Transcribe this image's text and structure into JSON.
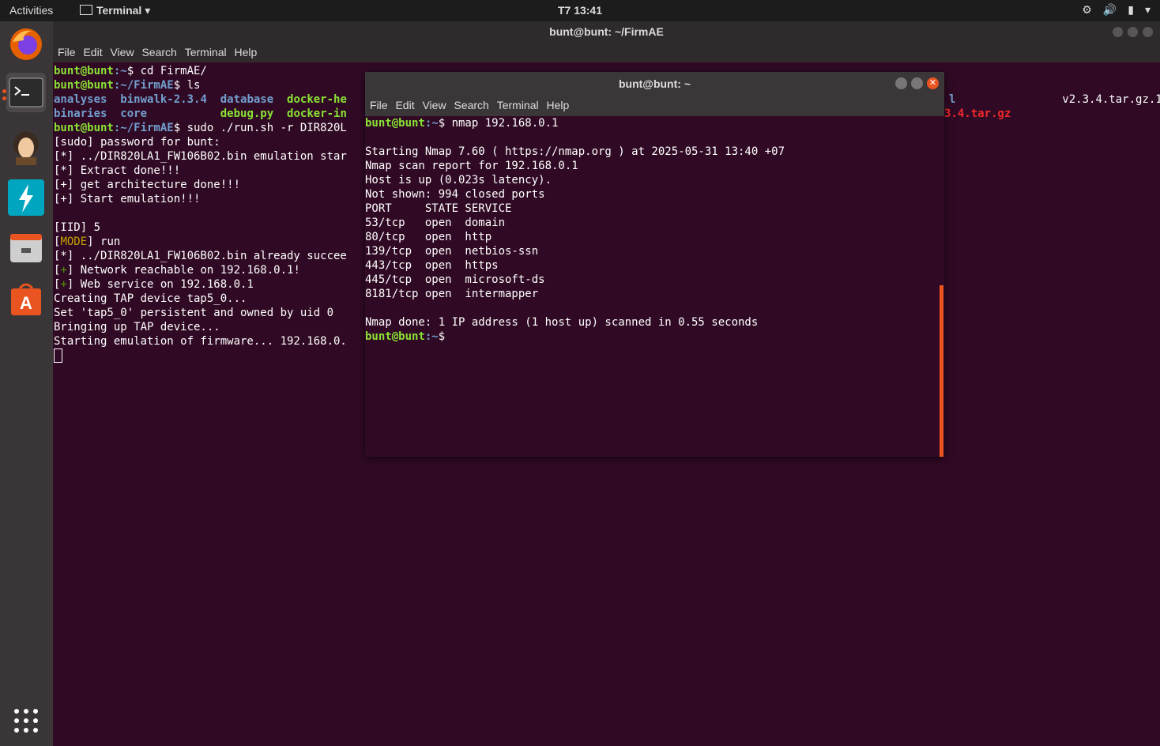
{
  "topbar": {
    "activities": "Activities",
    "app_menu": "Terminal",
    "clock": "T7 13:41"
  },
  "dock": {
    "items": [
      "firefox-icon",
      "terminal-icon",
      "gimp-icon",
      "zap-icon",
      "files-icon",
      "software-center-icon"
    ],
    "active": "terminal-icon",
    "accent": "#e95420"
  },
  "main_window": {
    "title": "bunt@bunt: ~/FirmAE",
    "menu": [
      "File",
      "Edit",
      "View",
      "Search",
      "Terminal",
      "Help"
    ],
    "lines": {
      "l1_prompt": "bunt@bunt",
      "l1_path": ":~",
      "l1_cmd": "$ cd FirmAE/",
      "l2_prompt": "bunt@bunt",
      "l2_path": ":~/FirmAE",
      "l2_cmd": "$ ls",
      "ls_row1_a": "analyses",
      "ls_row1_b": "binwalk-2.3.4",
      "ls_row1_c": "database",
      "ls_row1_d": "docker-he",
      "ls_row1_e": "l",
      "ls_row1_f": "v2.3.4.tar.gz.1",
      "ls_row2_a": "binaries",
      "ls_row2_b": "core",
      "ls_row2_c": "debug.py",
      "ls_row2_d": "docker-in",
      "ls_row2_e": "3.4.tar.gz",
      "l5_prompt": "bunt@bunt",
      "l5_path": ":~/FirmAE",
      "l5_cmd": "$ sudo ./run.sh -r DIR820L",
      "l6": "[sudo] password for bunt:",
      "l7": "[*] ../DIR820LA1_FW106B02.bin emulation star",
      "l8": "[*] Extract done!!!",
      "l9": "[+] get architecture done!!!",
      "l10": "[+] Start emulation!!!",
      "l11": "",
      "l12": "[IID] 5",
      "l13_open": "[",
      "l13_mode": "MODE",
      "l13_close": "] run",
      "l14": "[*] ../DIR820LA1_FW106B02.bin already succee",
      "l15_open": "[",
      "l15_plus": "+",
      "l15_rest": "] Network reachable on 192.168.0.1!",
      "l16_open": "[",
      "l16_plus": "+",
      "l16_rest": "] Web service on 192.168.0.1",
      "l17": "Creating TAP device tap5_0...",
      "l18": "Set 'tap5_0' persistent and owned by uid 0",
      "l19": "Bringing up TAP device...",
      "l20": "Starting emulation of firmware... 192.168.0."
    }
  },
  "second_window": {
    "title": "bunt@bunt: ~",
    "menu": [
      "File",
      "Edit",
      "View",
      "Search",
      "Terminal",
      "Help"
    ],
    "prompt": "bunt@bunt",
    "path": ":~",
    "cmd": "$ nmap 192.168.0.1",
    "out": [
      "",
      "Starting Nmap 7.60 ( https://nmap.org ) at 2025-05-31 13:40 +07",
      "Nmap scan report for 192.168.0.1",
      "Host is up (0.023s latency).",
      "Not shown: 994 closed ports",
      "PORT     STATE SERVICE",
      "53/tcp   open  domain",
      "80/tcp   open  http",
      "139/tcp  open  netbios-ssn",
      "443/tcp  open  https",
      "445/tcp  open  microsoft-ds",
      "8181/tcp open  intermapper",
      "",
      "Nmap done: 1 IP address (1 host up) scanned in 0.55 seconds"
    ],
    "end_prompt": "bunt@bunt",
    "end_path": ":~",
    "end_cmd": "$"
  }
}
